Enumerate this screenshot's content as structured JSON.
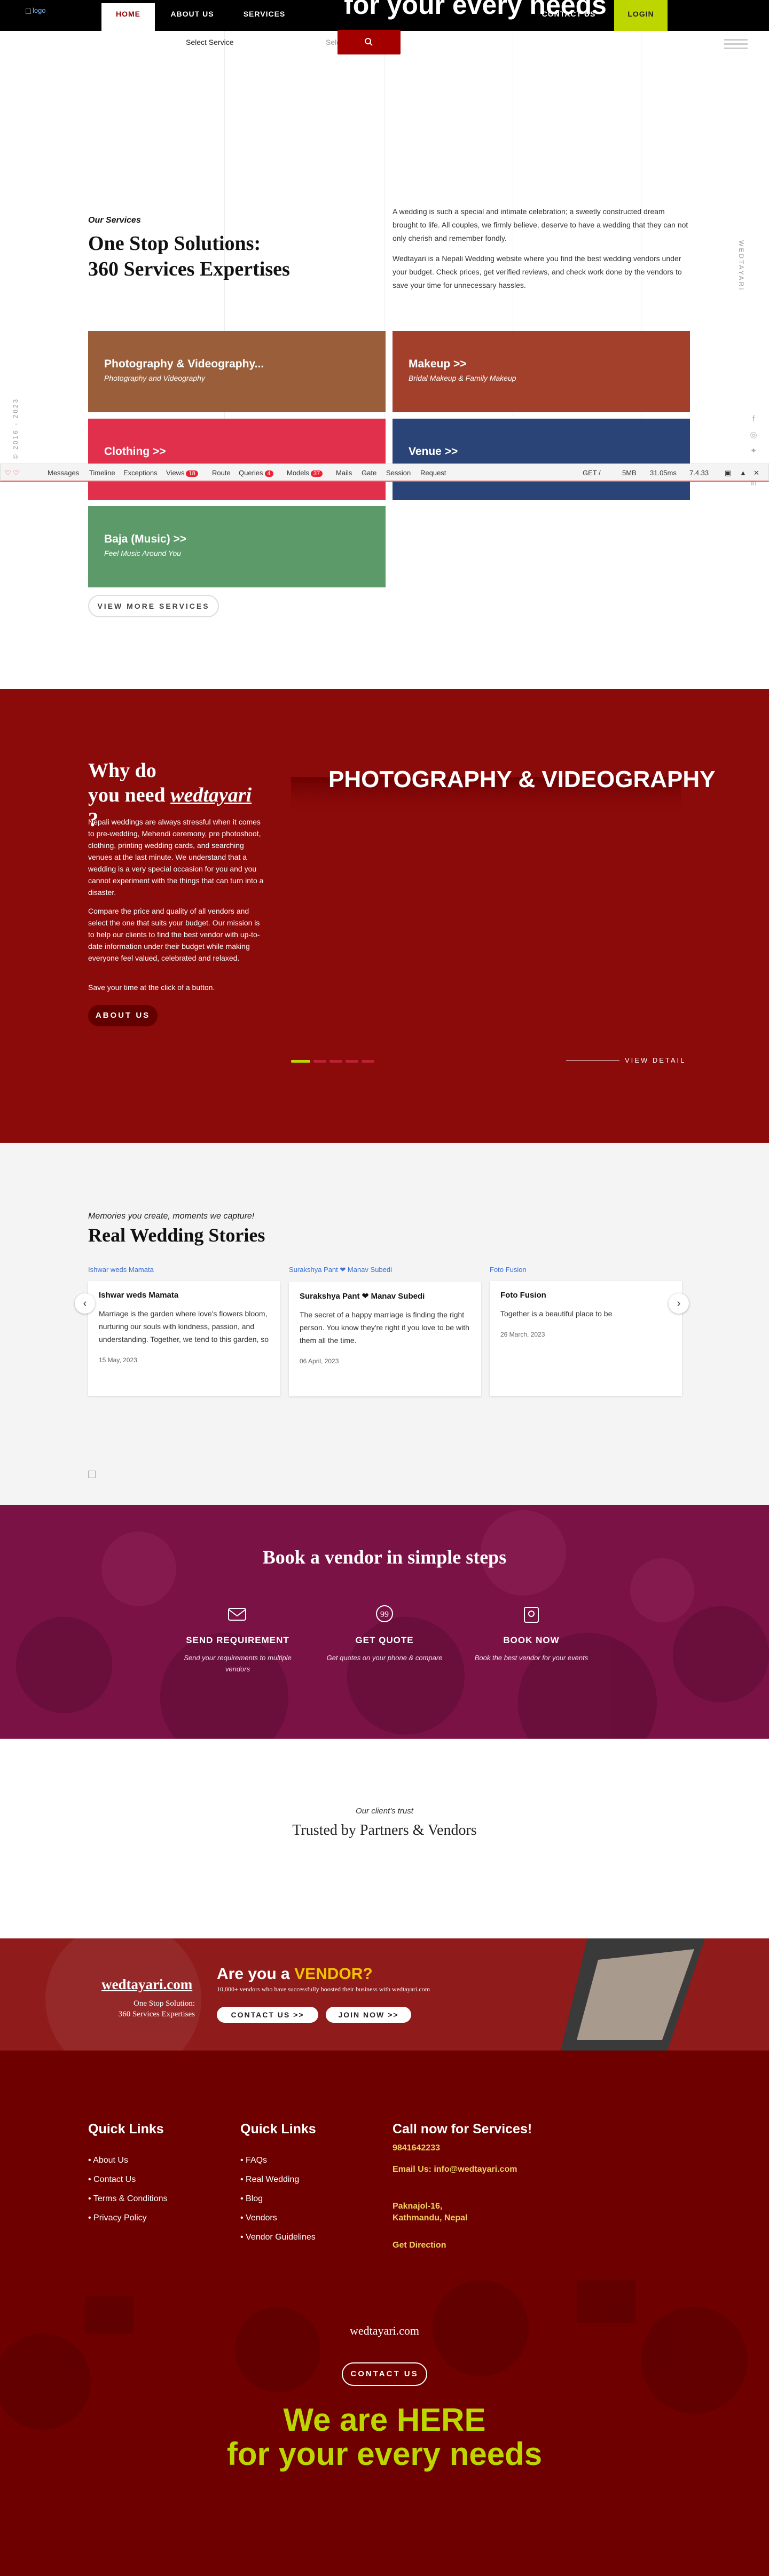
{
  "nav": {
    "logo_alt": "logo",
    "hero_heading": "for your every needs",
    "items": [
      "HOME",
      "ABOUT US",
      "SERVICES",
      "CONTACT US",
      "LOGIN"
    ]
  },
  "search": {
    "service": "Select Service",
    "location": "Sele.t Location"
  },
  "services": {
    "label": "Our Services",
    "title": "One Stop Solutions:\n360 Services Expertises",
    "p1": "A wedding is such a special and intimate celebration; a sweetly constructed dream brought to life. All couples, we firmly believe, deserve to have a wedding that they can not only cherish and remember fondly.",
    "p2": "Wedtayari is a Nepali Wedding website where you find the best wedding vendors under your budget. Check prices, get verified reviews, and check work done by the vendors to save your time for unnecessary hassles.",
    "side_right": "WEDTAYARI",
    "side_left": "© 2016 - 2023",
    "cards": [
      {
        "t": "Photography & Videography...",
        "s": "Photography and Videography",
        "c": "#9a5f3a"
      },
      {
        "t": "Makeup  >>",
        "s": "Bridal Makeup & Family Makeup",
        "c": "#a3402b"
      },
      {
        "t": "Clothing  >>",
        "s": "",
        "c": "#e0304b"
      },
      {
        "t": "Venue  >>",
        "s": "",
        "c": "#2b4478"
      },
      {
        "t": "Baja (Music)  >>",
        "s": "Feel Music Around You",
        "c": "#5d9a6a"
      }
    ],
    "view_more": "VIEW MORE SERVICES"
  },
  "debugbar": {
    "tabs": [
      "Messages",
      "Timeline",
      "Exceptions",
      "Views",
      "Route",
      "Queries",
      "Models",
      "Mails",
      "Gate",
      "Session",
      "Request"
    ],
    "badges": {
      "Views": "18",
      "Queries": "4",
      "Models": "37"
    },
    "stats": [
      "GET /",
      "5MB",
      "31.05ms",
      "7.4.33"
    ]
  },
  "why": {
    "title1": "Why do",
    "title2": "you need ",
    "brand": "wedtayari",
    "title3": " ?",
    "p1": "Nepali weddings are always stressful when it comes to pre-wedding, Mehendi ceremony, pre photoshoot, clothing, printing wedding cards, and searching venues at the last minute. We understand that a wedding is a very special occasion for you and you cannot experiment with the things that can turn into a disaster.",
    "p2": "Compare the price and quality of all vendors and select the one that suits your budget. Our mission is to help our clients to find the best vendor with up-to-date information under their budget while making everyone feel valued, celebrated and relaxed.",
    "p3": "Save your time at the click of a button.",
    "button": "ABOUT US",
    "slide_title": "PHOTOGRAPHY & VIDEOGRAPHY",
    "view_detail": "VIEW DETAIL"
  },
  "stories": {
    "subtitle": "Memories you create, moments we capture!",
    "title": "Real Wedding Stories",
    "items": [
      {
        "img": "Ishwar weds Mamata",
        "name": "Ishwar weds Mamata",
        "text": "Marriage is the garden where love's flowers bloom, nurturing our souls with kindness, passion, and understanding. Together, we tend to this garden, so",
        "date": "15 May, 2023"
      },
      {
        "img": "Surakshya Pant ❤ Manav Subedi",
        "name": "Surakshya Pant ❤ Manav Subedi",
        "text": "The secret of a happy marriage is finding the right person. You know they're right if you love to be with them all the time.",
        "date": "06 April, 2023"
      },
      {
        "img": "Foto Fusion",
        "name": "Foto Fusion",
        "text": "Together is a beautiful place to be",
        "date": "26 March, 2023"
      }
    ]
  },
  "steps": {
    "title": "Book a vendor in simple steps",
    "items": [
      {
        "h": "SEND REQUIREMENT",
        "s": "Send your requirements to multiple vendors"
      },
      {
        "h": "GET QUOTE",
        "s": "Get quotes on your phone & compare"
      },
      {
        "h": "BOOK NOW",
        "s": "Book the best vendor for your events"
      }
    ]
  },
  "trust": {
    "subtitle": "Our client's trust",
    "title": "Trusted by Partners & Vendors"
  },
  "vendor": {
    "logo": "wedtayari.com",
    "tag1": "One Stop Solution:",
    "tag2": "360 Services Expertises",
    "h1": "Are you a ",
    "h2": "VENDOR?",
    "sub": "10,000+ vendors who have successfully boosted their business with wedtayari.com",
    "b1": "CONTACT US >>",
    "b2": "JOIN NOW >>"
  },
  "footer": {
    "col1": {
      "h": "Quick Links",
      "items": [
        "About Us",
        "Contact Us",
        "Terms & Conditions",
        "Privacy Policy"
      ]
    },
    "col2": {
      "h": "Quick Links",
      "items": [
        "FAQs",
        "Real Wedding",
        "Blog",
        "Vendors",
        "Vendor Guidelines"
      ]
    },
    "col3": {
      "h": "Call now for Services!",
      "phone": "9841642233",
      "email": "Email Us: info@wedtayari.com",
      "addr1": "Paknajol-16,",
      "addr2": "Kathmandu, Nepal",
      "dir": "Get Direction"
    },
    "brand": "wedtayari.com",
    "contact": "CONTACT US",
    "big1": "We are HERE",
    "big2": "for your every needs"
  },
  "colors": {
    "brand": "#8b0a0a",
    "accent": "#bdd600",
    "login": "#bdd600",
    "footer": "#6e0000"
  }
}
